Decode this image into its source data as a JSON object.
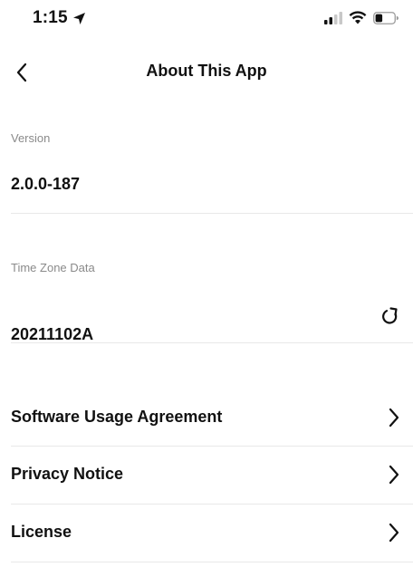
{
  "status_bar": {
    "time": "1:15",
    "location_icon": "location-arrow-icon",
    "signal_icon": "cellular-signal-icon",
    "wifi_icon": "wifi-icon",
    "battery_icon": "battery-icon"
  },
  "nav": {
    "title": "About This App",
    "back_icon": "chevron-left-icon"
  },
  "version": {
    "caption": "Version",
    "value": "2.0.0-187"
  },
  "timezone": {
    "caption": "Time Zone Data",
    "value": "20211102A",
    "refresh_icon": "refresh-icon"
  },
  "links": [
    {
      "label": "Software Usage Agreement",
      "icon": "chevron-right-icon"
    },
    {
      "label": "Privacy Notice",
      "icon": "chevron-right-icon"
    },
    {
      "label": "License",
      "icon": "chevron-right-icon"
    }
  ],
  "colors": {
    "text": "#111111",
    "caption": "#8a8a8a",
    "divider": "#e8e8e8",
    "background": "#ffffff"
  }
}
